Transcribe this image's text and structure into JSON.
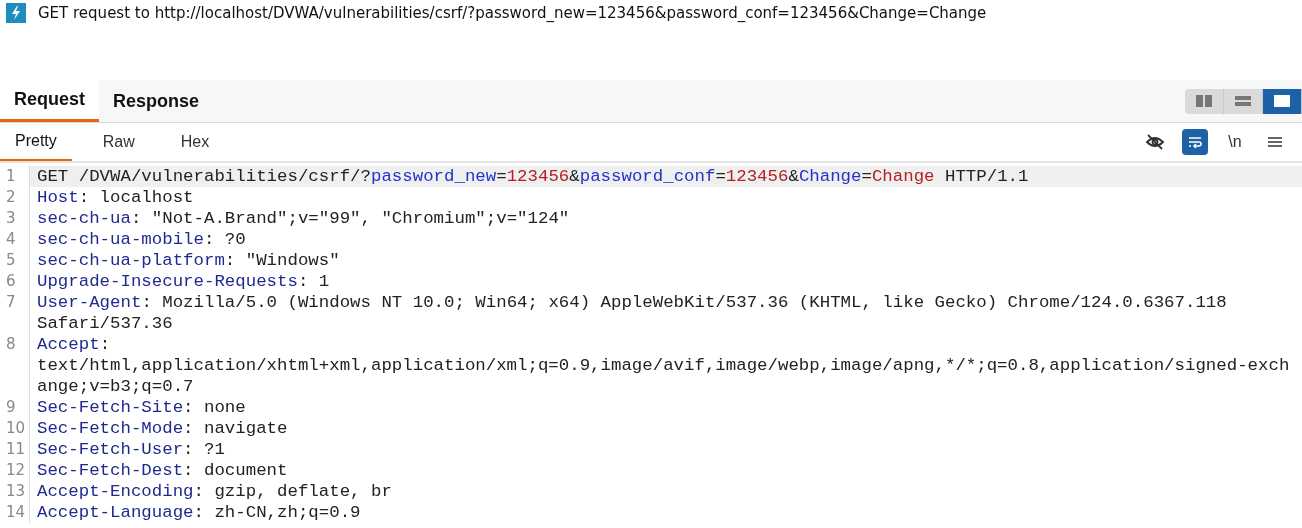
{
  "title": "GET request to http://localhost/DVWA/vulnerabilities/csrf/?password_new=123456&password_conf=123456&Change=Change",
  "tabs": [
    {
      "label": "Request",
      "selected": true
    },
    {
      "label": "Response",
      "selected": false
    }
  ],
  "layouts": [
    {
      "kind": "split-vertical",
      "selected": false
    },
    {
      "kind": "split-horizontal",
      "selected": false
    },
    {
      "kind": "single",
      "selected": true
    }
  ],
  "view_tabs": [
    {
      "label": "Pretty",
      "selected": true
    },
    {
      "label": "Raw",
      "selected": false
    },
    {
      "label": "Hex",
      "selected": false
    }
  ],
  "toolbar": [
    {
      "kind": "hide",
      "on": false
    },
    {
      "kind": "wrap",
      "on": true
    },
    {
      "kind": "newline",
      "text": "\\n",
      "on": false
    },
    {
      "kind": "menu",
      "on": false
    }
  ],
  "lines": [
    {
      "number": "1",
      "highlighted": true,
      "rows": [
        [
          {
            "kind": "plain",
            "text": "GET /DVWA/vulnerabilities/csrf/?"
          },
          {
            "kind": "param",
            "text": "password_new"
          },
          {
            "kind": "plain",
            "text": "="
          },
          {
            "kind": "value",
            "text": "123456"
          },
          {
            "kind": "plain",
            "text": "&"
          },
          {
            "kind": "param",
            "text": "password_conf"
          },
          {
            "kind": "plain",
            "text": "="
          },
          {
            "kind": "value",
            "text": "123456"
          },
          {
            "kind": "plain",
            "text": "&"
          },
          {
            "kind": "param",
            "text": "Change"
          },
          {
            "kind": "plain",
            "text": "="
          },
          {
            "kind": "value",
            "text": "Change"
          },
          {
            "kind": "plain",
            "text": " HTTP/1.1"
          }
        ]
      ]
    },
    {
      "number": "2",
      "highlighted": false,
      "rows": [
        [
          {
            "kind": "key",
            "text": "Host"
          },
          {
            "kind": "plain",
            "text": ": localhost"
          }
        ]
      ]
    },
    {
      "number": "3",
      "highlighted": false,
      "rows": [
        [
          {
            "kind": "key",
            "text": "sec-ch-ua"
          },
          {
            "kind": "plain",
            "text": ": \"Not-A.Brand\";v=\"99\", \"Chromium\";v=\"124\""
          }
        ]
      ]
    },
    {
      "number": "4",
      "highlighted": false,
      "rows": [
        [
          {
            "kind": "key",
            "text": "sec-ch-ua-mobile"
          },
          {
            "kind": "plain",
            "text": ": ?0"
          }
        ]
      ]
    },
    {
      "number": "5",
      "highlighted": false,
      "rows": [
        [
          {
            "kind": "key",
            "text": "sec-ch-ua-platform"
          },
          {
            "kind": "plain",
            "text": ": \"Windows\""
          }
        ]
      ]
    },
    {
      "number": "6",
      "highlighted": false,
      "rows": [
        [
          {
            "kind": "key",
            "text": "Upgrade-Insecure-Requests"
          },
          {
            "kind": "plain",
            "text": ": 1"
          }
        ]
      ]
    },
    {
      "number": "7",
      "highlighted": false,
      "rows": [
        [
          {
            "kind": "key",
            "text": "User-Agent"
          },
          {
            "kind": "plain",
            "text": ": Mozilla/5.0 (Windows NT 10.0; Win64; x64) AppleWebKit/537.36 (KHTML, like Gecko) Chrome/124.0.6367.118"
          }
        ],
        [
          {
            "kind": "plain",
            "text": "Safari/537.36"
          }
        ]
      ]
    },
    {
      "number": "8",
      "highlighted": false,
      "rows": [
        [
          {
            "kind": "key",
            "text": "Accept"
          },
          {
            "kind": "plain",
            "text": ":"
          }
        ],
        [
          {
            "kind": "plain",
            "text": "text/html,application/xhtml+xml,application/xml;q=0.9,image/avif,image/webp,image/apng,*/*;q=0.8,application/signed-exch"
          }
        ],
        [
          {
            "kind": "plain",
            "text": "ange;v=b3;q=0.7"
          }
        ]
      ]
    },
    {
      "number": "9",
      "highlighted": false,
      "rows": [
        [
          {
            "kind": "key",
            "text": "Sec-Fetch-Site"
          },
          {
            "kind": "plain",
            "text": ": none"
          }
        ]
      ]
    },
    {
      "number": "10",
      "highlighted": false,
      "rows": [
        [
          {
            "kind": "key",
            "text": "Sec-Fetch-Mode"
          },
          {
            "kind": "plain",
            "text": ": navigate"
          }
        ]
      ]
    },
    {
      "number": "11",
      "highlighted": false,
      "rows": [
        [
          {
            "kind": "key",
            "text": "Sec-Fetch-User"
          },
          {
            "kind": "plain",
            "text": ": ?1"
          }
        ]
      ]
    },
    {
      "number": "12",
      "highlighted": false,
      "rows": [
        [
          {
            "kind": "key",
            "text": "Sec-Fetch-Dest"
          },
          {
            "kind": "plain",
            "text": ": document"
          }
        ]
      ]
    },
    {
      "number": "13",
      "highlighted": false,
      "rows": [
        [
          {
            "kind": "key",
            "text": "Accept-Encoding"
          },
          {
            "kind": "plain",
            "text": ": gzip, deflate, br"
          }
        ]
      ]
    },
    {
      "number": "14",
      "highlighted": false,
      "rows": [
        [
          {
            "kind": "key",
            "text": "Accept-Language"
          },
          {
            "kind": "plain",
            "text": ": zh-CN,zh;q=0.9"
          }
        ]
      ]
    }
  ]
}
